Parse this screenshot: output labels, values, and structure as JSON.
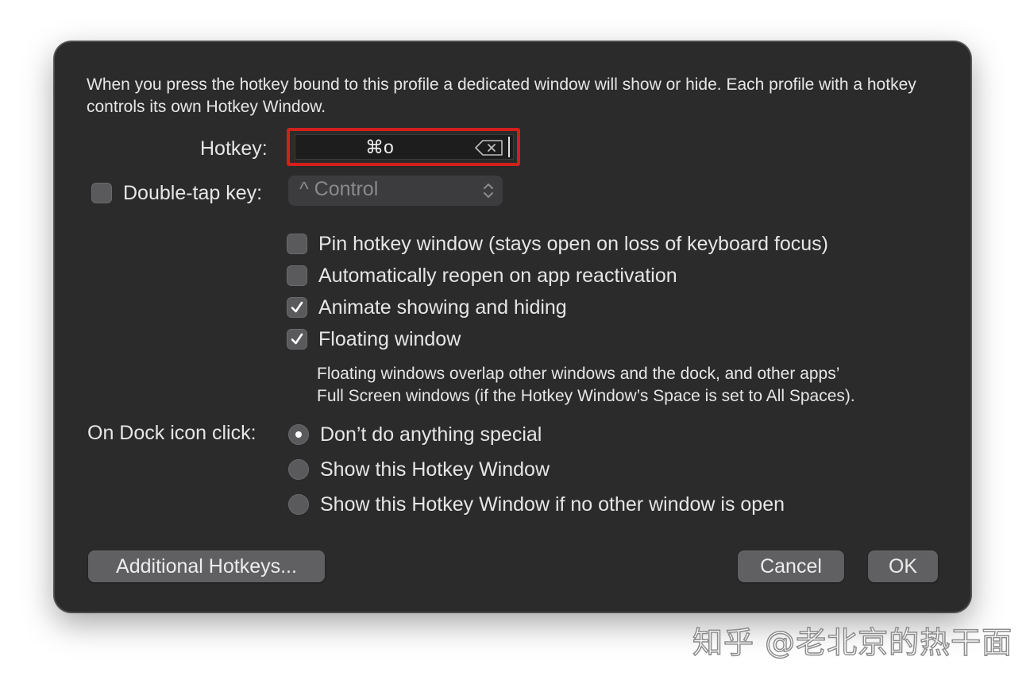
{
  "dialog": {
    "intro": "When you press the hotkey bound to this profile a dedicated window will show or hide. Each profile with a hotkey controls its own Hotkey Window.",
    "hotkey_label": "Hotkey:",
    "hotkey_value": "⌘o",
    "double_tap_label": "Double-tap key:",
    "double_tap_checked": false,
    "double_tap_popup_value": "^ Control",
    "options": [
      {
        "label": "Pin hotkey window (stays open on loss of keyboard focus)",
        "checked": false
      },
      {
        "label": "Automatically reopen on app reactivation",
        "checked": false
      },
      {
        "label": "Animate showing and hiding",
        "checked": true
      },
      {
        "label": "Floating window",
        "checked": true
      }
    ],
    "floating_note_line1": "Floating windows overlap other windows and the dock, and other apps’",
    "floating_note_line2": "Full Screen windows (if the Hotkey Window’s Space is set to All Spaces).",
    "dock_click_label": "On Dock icon click:",
    "dock_click_options": [
      {
        "label": "Don’t do anything special",
        "selected": true
      },
      {
        "label": "Show this Hotkey Window",
        "selected": false
      },
      {
        "label": "Show this Hotkey Window if no other window is open",
        "selected": false
      }
    ],
    "buttons": {
      "additional_hotkeys": "Additional Hotkeys...",
      "cancel": "Cancel",
      "ok": "OK"
    }
  },
  "watermark": "知乎 @老北京的热干面",
  "colors": {
    "dialog_bg": "#2b2b2c",
    "highlight_border": "#d41f1a",
    "text": "#e6e6e6"
  }
}
